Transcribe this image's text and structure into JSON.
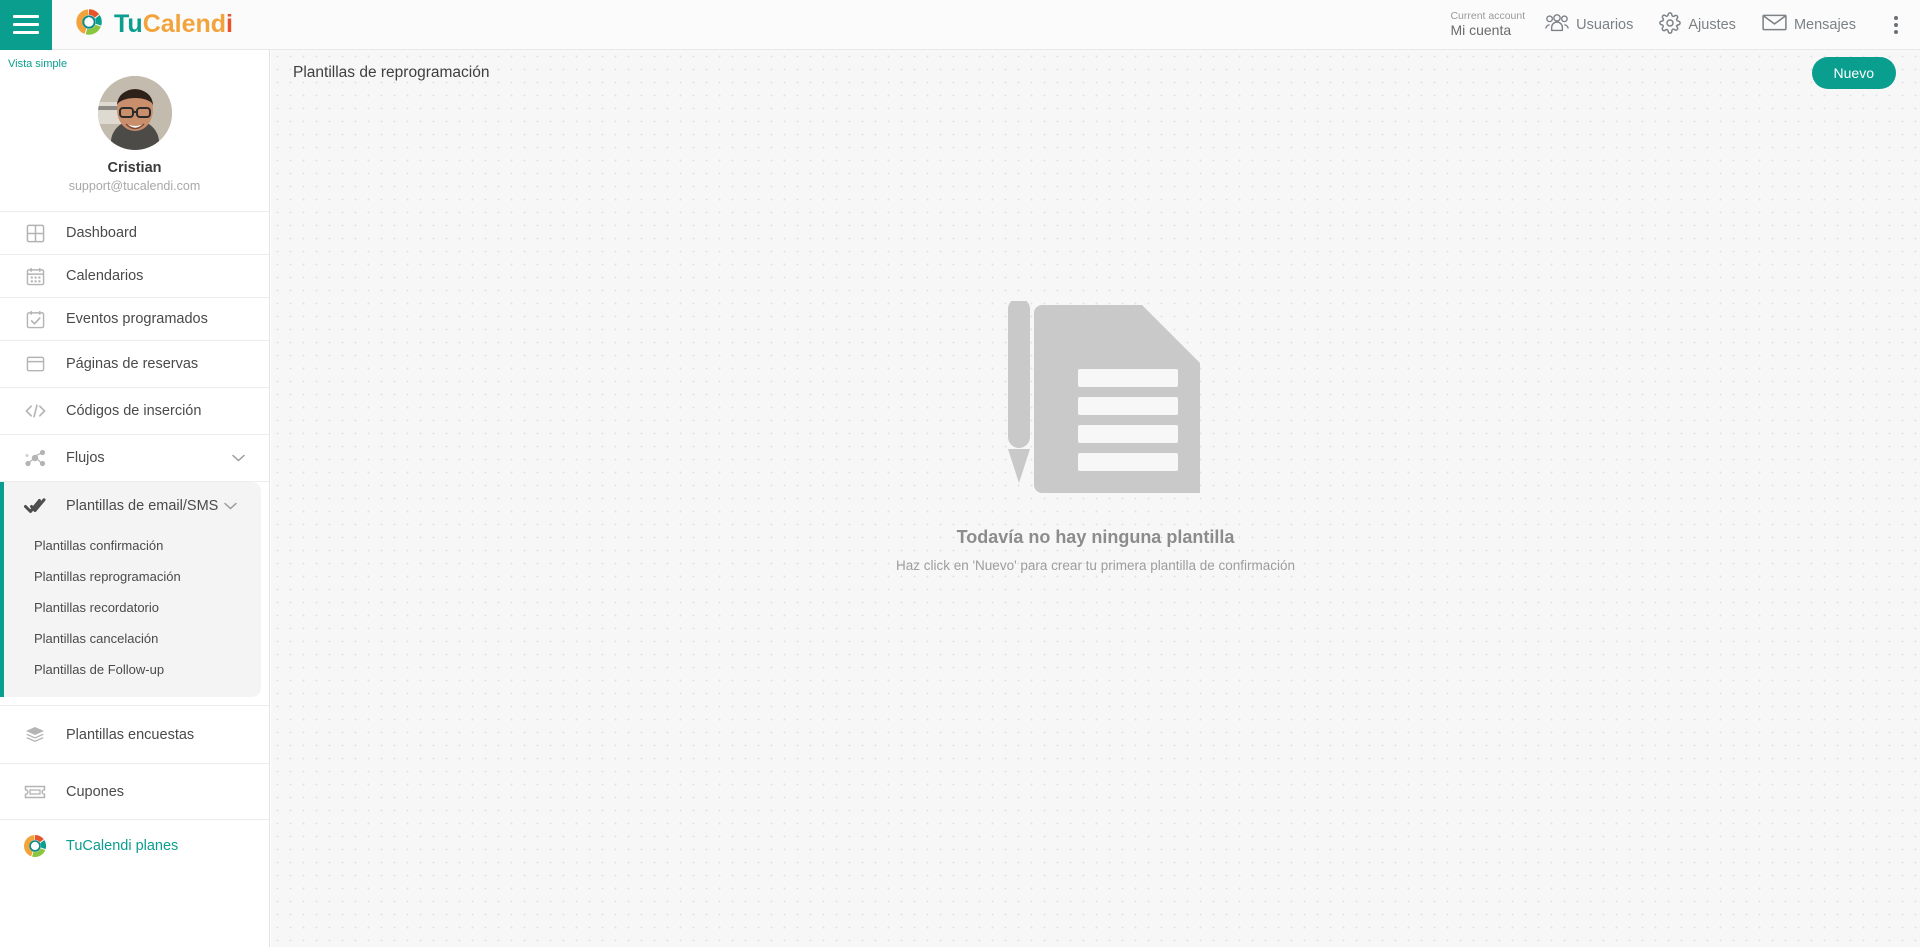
{
  "topbar": {
    "menu_icon": "hamburger-icon",
    "brand": {
      "part1": "Tu",
      "part2": "Calend",
      "part3": "i",
      "logo_icon": "tucalendi-logo-icon"
    },
    "account": {
      "caption": "Current account",
      "value": "Mi cuenta"
    },
    "nav": [
      {
        "label": "Usuarios",
        "icon": "users-icon"
      },
      {
        "label": "Ajustes",
        "icon": "gear-icon"
      },
      {
        "label": "Mensajes",
        "icon": "envelope-icon"
      }
    ],
    "overflow_icon": "kebab-menu-icon"
  },
  "sidebar": {
    "view_toggle": "Vista simple",
    "profile": {
      "name": "Cristian",
      "email": "support@tucalendi.com",
      "avatar": "user-avatar"
    },
    "items": [
      {
        "label": "Dashboard",
        "icon": "dashboard-grid-icon",
        "expandable": false
      },
      {
        "label": "Calendarios",
        "icon": "calendar-icon",
        "expandable": false
      },
      {
        "label": "Eventos programados",
        "icon": "calendar-check-icon",
        "expandable": false
      },
      {
        "label": "Páginas de reservas",
        "icon": "window-icon",
        "expandable": false
      },
      {
        "label": "Códigos de inserción",
        "icon": "code-brackets-icon",
        "expandable": false
      },
      {
        "label": "Flujos",
        "icon": "flow-nodes-icon",
        "expandable": true
      }
    ],
    "active_group": {
      "label": "Plantillas de email/SMS",
      "icon": "double-check-icon",
      "expandable": true,
      "subitems": [
        "Plantillas confirmación",
        "Plantillas reprogramación",
        "Plantillas recordatorio",
        "Plantillas cancelación",
        "Plantillas de Follow-up"
      ]
    },
    "items_after": [
      {
        "label": "Plantillas encuestas",
        "icon": "layers-icon",
        "expandable": false
      },
      {
        "label": "Cupones",
        "icon": "ticket-icon",
        "expandable": false
      }
    ],
    "plans": {
      "label": "TuCalendi planes",
      "icon": "tucalendi-logo-icon"
    }
  },
  "main": {
    "page_title": "Plantillas de reprogramación",
    "new_button": "Nuevo",
    "empty_state": {
      "illustration": "document-pencil-icon",
      "title": "Todavía no hay ninguna plantilla",
      "subtitle": "Haz click en 'Nuevo' para crear tu primera plantilla de confirmación"
    }
  },
  "colors": {
    "accent": "#0a9e8e",
    "brand_orange": "#f2a33c",
    "brand_red": "#e8542a",
    "brand_green": "#8cc63f",
    "canvas": "#f7f7f7"
  }
}
